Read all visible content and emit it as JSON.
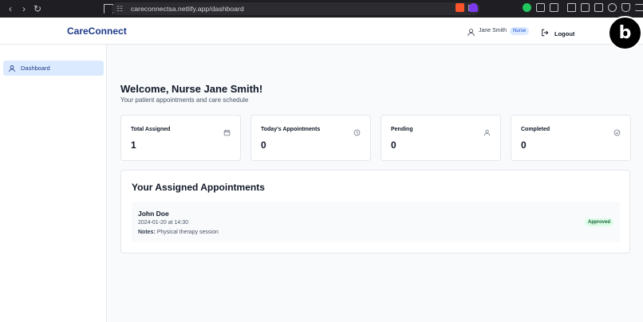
{
  "browser": {
    "url": "careconnectsa.netlify.app/dashboard"
  },
  "header": {
    "brand": "CareConnect",
    "user_name": "Jane Smith",
    "role": "Nurse",
    "logout_label": "Logout"
  },
  "sidebar": {
    "items": [
      {
        "label": "Dashboard",
        "icon": "user-icon",
        "active": true
      }
    ]
  },
  "main": {
    "welcome": "Welcome, Nurse Jane Smith!",
    "subtitle": "Your patient appointments and care schedule",
    "stats": [
      {
        "label": "Total Assigned",
        "value": "1",
        "icon": "calendar-icon"
      },
      {
        "label": "Today's Appointments",
        "value": "0",
        "icon": "clock-icon"
      },
      {
        "label": "Pending",
        "value": "0",
        "icon": "user-icon"
      },
      {
        "label": "Completed",
        "value": "0",
        "icon": "check-circle-icon"
      }
    ],
    "appointments": {
      "title": "Your Assigned Appointments",
      "items": [
        {
          "patient": "John Doe",
          "datetime": "2024-01-20 at 14:30",
          "notes_label": "Notes:",
          "notes": "Physical therapy session",
          "status": "Approved"
        }
      ]
    }
  },
  "colors": {
    "brand": "#1e3a8a",
    "active_nav_bg": "#dbeafe",
    "badge_role_bg": "#dbeafe",
    "status_approved_bg": "#dcfce7",
    "status_approved_text": "#166534"
  }
}
